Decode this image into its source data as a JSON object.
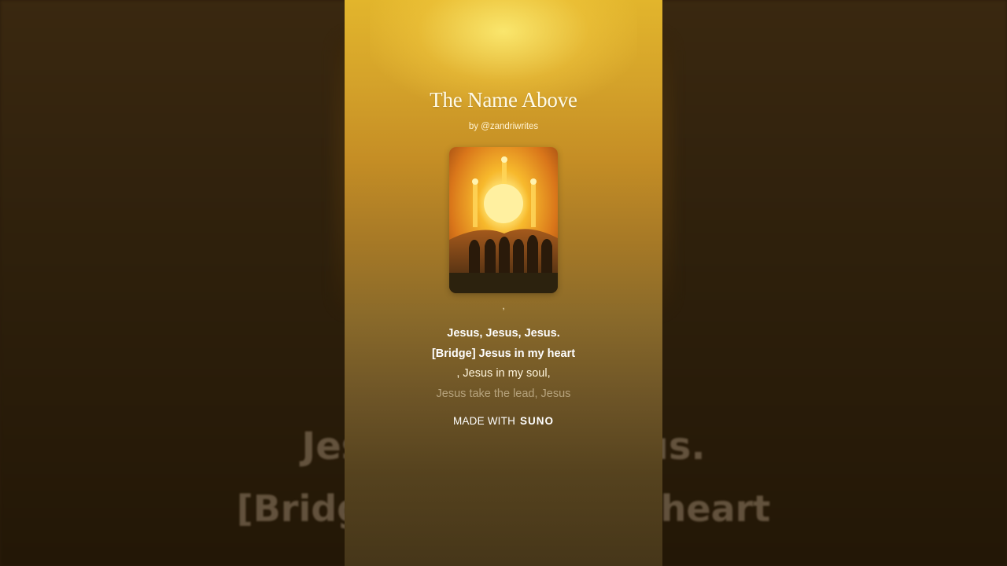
{
  "song": {
    "title": "The Name Above",
    "byline": "by @zandriwrites"
  },
  "cover_art": {
    "icon": "album-cover-sun-figures",
    "colors": {
      "sky": "#f0a318",
      "sun": "#ffe97a",
      "ground": "#2c220e"
    }
  },
  "lyrics": {
    "separator": ",",
    "lines": [
      "Jesus, Jesus, Jesus.",
      "[Bridge] Jesus in my heart",
      ", Jesus in my soul,",
      "Jesus take the lead, Jesus"
    ]
  },
  "footer": {
    "made_with": "MADE WITH",
    "brand": "SUNO"
  },
  "background_lyrics": {
    "line1": "Jesus, Jesus, Jesus.",
    "line2": "[Bridge] Jesus in my heart"
  }
}
